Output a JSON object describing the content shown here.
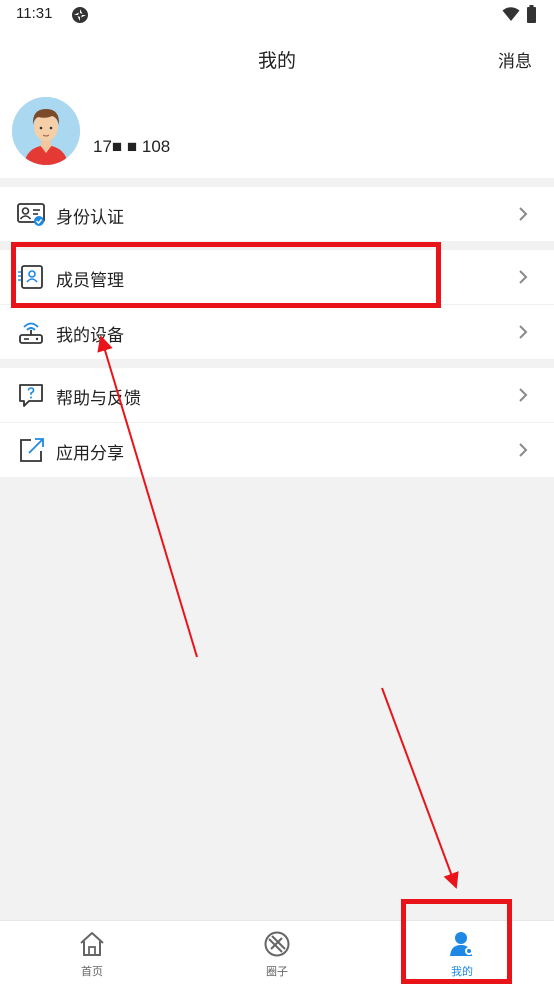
{
  "status_bar": {
    "time": "11:31"
  },
  "header": {
    "title": "我的",
    "messages_label": "消息"
  },
  "profile": {
    "phone": "17■ ■ 108"
  },
  "menu": {
    "group1": [
      {
        "label": "身份认证",
        "icon": "id-card-icon"
      },
      {
        "label": "成员管理",
        "icon": "member-card-icon"
      },
      {
        "label": "我的设备",
        "icon": "router-icon"
      }
    ],
    "group2": [
      {
        "label": "帮助与反馈",
        "icon": "help-chat-icon"
      },
      {
        "label": "应用分享",
        "icon": "share-icon"
      }
    ]
  },
  "tab_bar": {
    "tabs": [
      {
        "label": "首页",
        "icon": "home-icon"
      },
      {
        "label": "圈子",
        "icon": "circle-icon"
      },
      {
        "label": "我的",
        "icon": "user-icon",
        "active": true
      }
    ]
  },
  "colors": {
    "accent": "#1e88e5",
    "annotation": "#e8141a",
    "background": "#f2f2f2"
  }
}
